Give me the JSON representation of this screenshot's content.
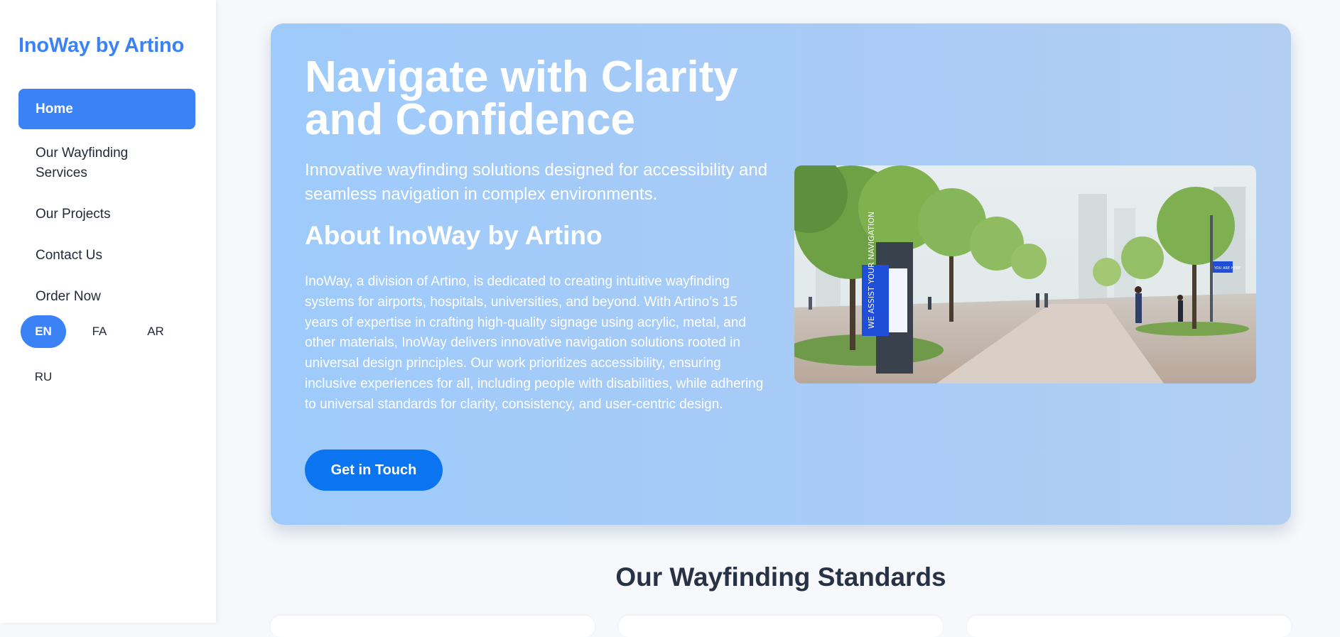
{
  "brand": "InoWay by Artino",
  "nav": {
    "items": [
      {
        "label": "Home"
      },
      {
        "label": "Our Wayfinding Services"
      },
      {
        "label": "Our Projects"
      },
      {
        "label": "Contact Us"
      },
      {
        "label": "Order Now"
      }
    ]
  },
  "languages": [
    "EN",
    "FA",
    "AR",
    "RU"
  ],
  "hero": {
    "title": "Navigate with Clarity and Confidence",
    "subtitle": "Innovative wayfinding solutions designed for accessibility and seamless navigation in complex environments.",
    "about_title": "About InoWay by Artino",
    "about_text": "InoWay, a division of Artino, is dedicated to creating intuitive wayfinding systems for airports, hospitals, universities, and beyond. With Artino’s 15 years of expertise in crafting high-quality signage using acrylic, metal, and other materials, InoWay delivers innovative navigation solutions rooted in universal design principles. Our work prioritizes accessibility, ensuring inclusive experiences for all, including people with disabilities, while adhering to universal standards for clarity, consistency, and user-centric design.",
    "cta_label": "Get in Touch",
    "image": {
      "kiosk_text": "WE ASSIST YOUR NAVIGATION",
      "sign_text": "YOU ARE HERE"
    }
  },
  "standards": {
    "title": "Our Wayfinding Standards"
  },
  "colors": {
    "accent": "#3b82f6",
    "cta": "#0b74f0",
    "hero_bg": "#a6cbf8"
  }
}
